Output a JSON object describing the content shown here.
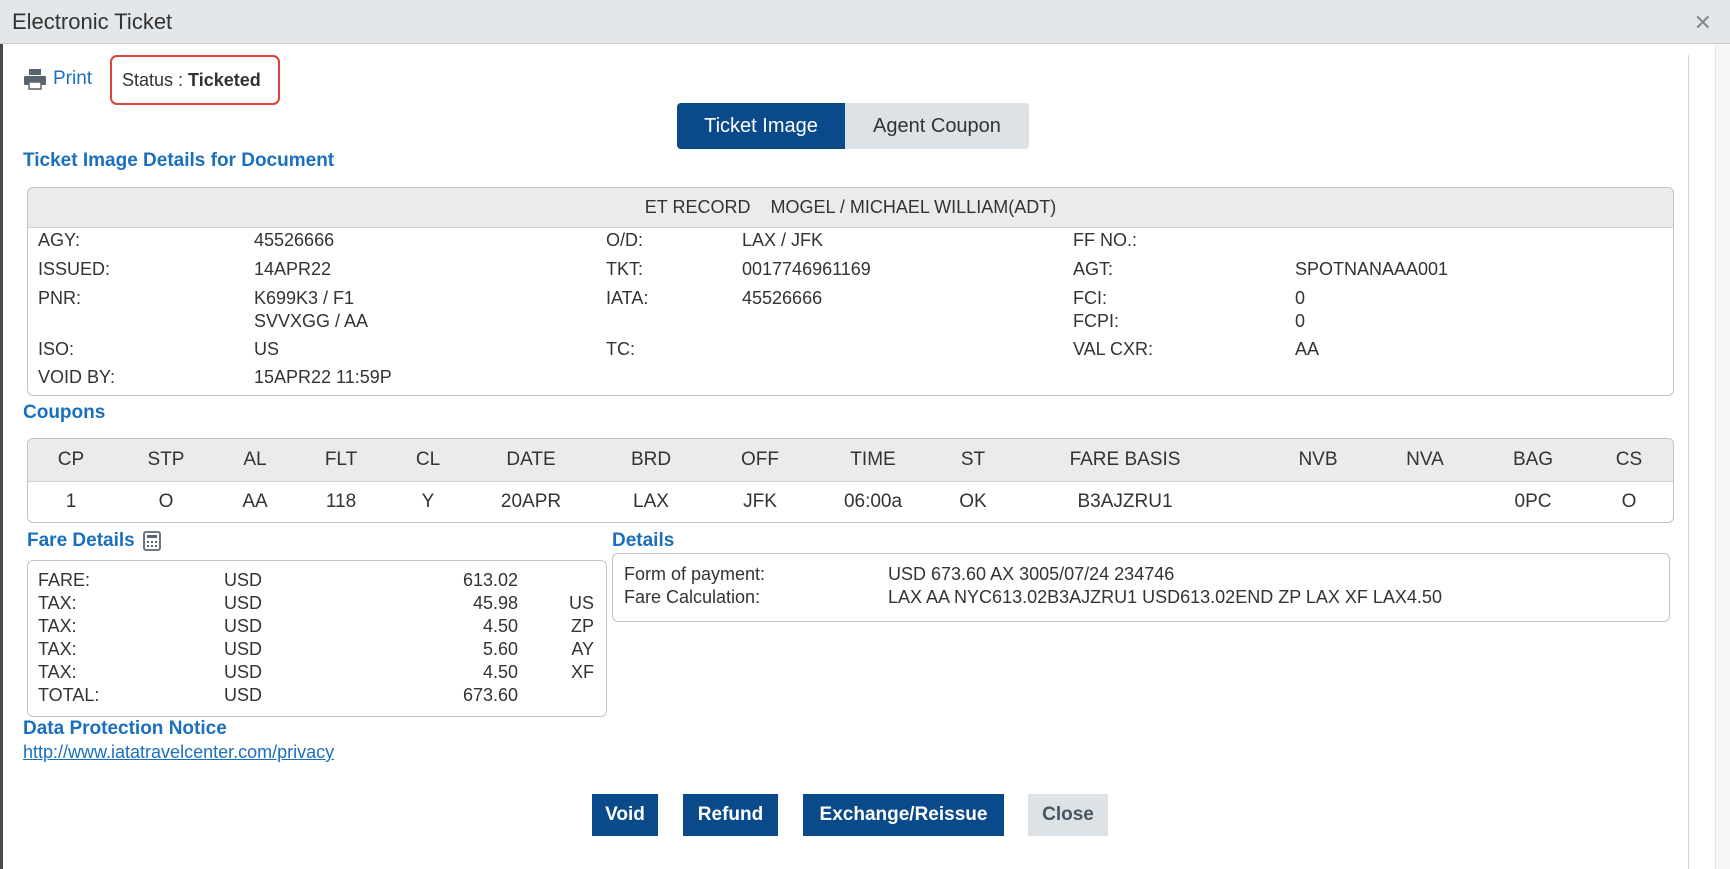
{
  "window": {
    "title": "Electronic Ticket"
  },
  "toolbar": {
    "print_label": "Print",
    "status_label": "Status : ",
    "status_value": "Ticketed"
  },
  "tabs": [
    {
      "label": "Ticket Image",
      "active": true
    },
    {
      "label": "Agent Coupon",
      "active": false
    }
  ],
  "sections": {
    "ticket_image_title": "Ticket Image Details for Document",
    "coupons_title": "Coupons",
    "fare_details_title": "Fare Details",
    "details_title": "Details",
    "data_protection_title": "Data Protection Notice"
  },
  "et_record": {
    "label": "ET RECORD",
    "passenger": "MOGEL / MICHAEL WILLIAM(ADT)",
    "fields": {
      "agy_label": "AGY:",
      "agy_value": "45526666",
      "issued_label": "ISSUED:",
      "issued_value": "14APR22",
      "pnr_label": "PNR:",
      "pnr_value_1": "K699K3 / F1",
      "pnr_value_2": "SVVXGG / AA",
      "iso_label": "ISO:",
      "iso_value": "US",
      "voidby_label": "VOID BY:",
      "voidby_value": "15APR22 11:59P",
      "od_label": "O/D:",
      "od_value": "LAX / JFK",
      "tkt_label": "TKT:",
      "tkt_value": "0017746961169",
      "iata_label": "IATA:",
      "iata_value": "45526666",
      "tc_label": "TC:",
      "ffno_label": "FF NO.:",
      "agt_label": "AGT:",
      "agt_value": "SPOTNANAAA001",
      "fci_label": "FCI:",
      "fci_value": "0",
      "fcpi_label": "FCPI:",
      "fcpi_value": "0",
      "valcxr_label": "VAL CXR:",
      "valcxr_value": "AA"
    }
  },
  "coupons": {
    "columns": [
      "CP",
      "STP",
      "AL",
      "FLT",
      "CL",
      "DATE",
      "BRD",
      "OFF",
      "TIME",
      "ST",
      "FARE BASIS",
      "NVB",
      "NVA",
      "BAG",
      "CS"
    ],
    "rows": [
      [
        "1",
        "O",
        "AA",
        "118",
        "Y",
        "20APR",
        "LAX",
        "JFK",
        "06:00a",
        "OK",
        "B3AJZRU1",
        "",
        "",
        "0PC",
        "O"
      ]
    ]
  },
  "fare_details": [
    {
      "label": "FARE:",
      "currency": "USD",
      "amount": "613.02",
      "code": ""
    },
    {
      "label": "TAX:",
      "currency": "USD",
      "amount": "45.98",
      "code": "US"
    },
    {
      "label": "TAX:",
      "currency": "USD",
      "amount": "4.50",
      "code": "ZP"
    },
    {
      "label": "TAX:",
      "currency": "USD",
      "amount": "5.60",
      "code": "AY"
    },
    {
      "label": "TAX:",
      "currency": "USD",
      "amount": "4.50",
      "code": "XF"
    },
    {
      "label": "TOTAL:",
      "currency": "USD",
      "amount": "673.60",
      "code": ""
    }
  ],
  "details": {
    "fop_label": "Form of payment:",
    "fop_value": "USD 673.60 AX 3005/07/24 234746",
    "calc_label": "Fare Calculation:",
    "calc_value": "LAX AA NYC613.02B3AJZRU1 USD613.02END ZP LAX XF LAX4.50"
  },
  "privacy_link": "http://www.iatatravelcenter.com/privacy",
  "buttons": {
    "void": "Void",
    "refund": "Refund",
    "exchange": "Exchange/Reissue",
    "close": "Close"
  },
  "colors": {
    "brand": "#0b4a8a",
    "link": "#1a6fbe",
    "status_border": "#d9433a"
  }
}
